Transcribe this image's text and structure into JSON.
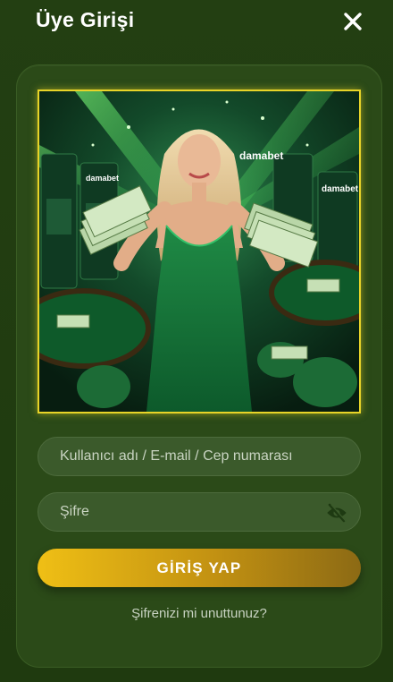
{
  "header": {
    "title": "Üye Girişi",
    "close_icon": "close-icon"
  },
  "hero": {
    "image_subject": "casino promotional illustration: woman in green sequin dress holding fanned cash, slot machines and tables, green light beams",
    "brand_signs": [
      "damabet",
      "damabet",
      "damabet"
    ],
    "frame_color": "#e8d428"
  },
  "form": {
    "username": {
      "placeholder": "Kullanıcı adı / E-mail / Cep numarası",
      "value": ""
    },
    "password": {
      "placeholder": "Şifre",
      "value": "",
      "toggle_icon": "eye-off-icon"
    },
    "login_label": "GİRİŞ YAP",
    "forgot_label": "Şifrenizi mi unuttunuz?"
  },
  "colors": {
    "background": "#213c10",
    "panel": "#2b4a18",
    "field": "#3b5a2b",
    "button_start": "#efbf15",
    "button_end": "#8c6a14"
  }
}
